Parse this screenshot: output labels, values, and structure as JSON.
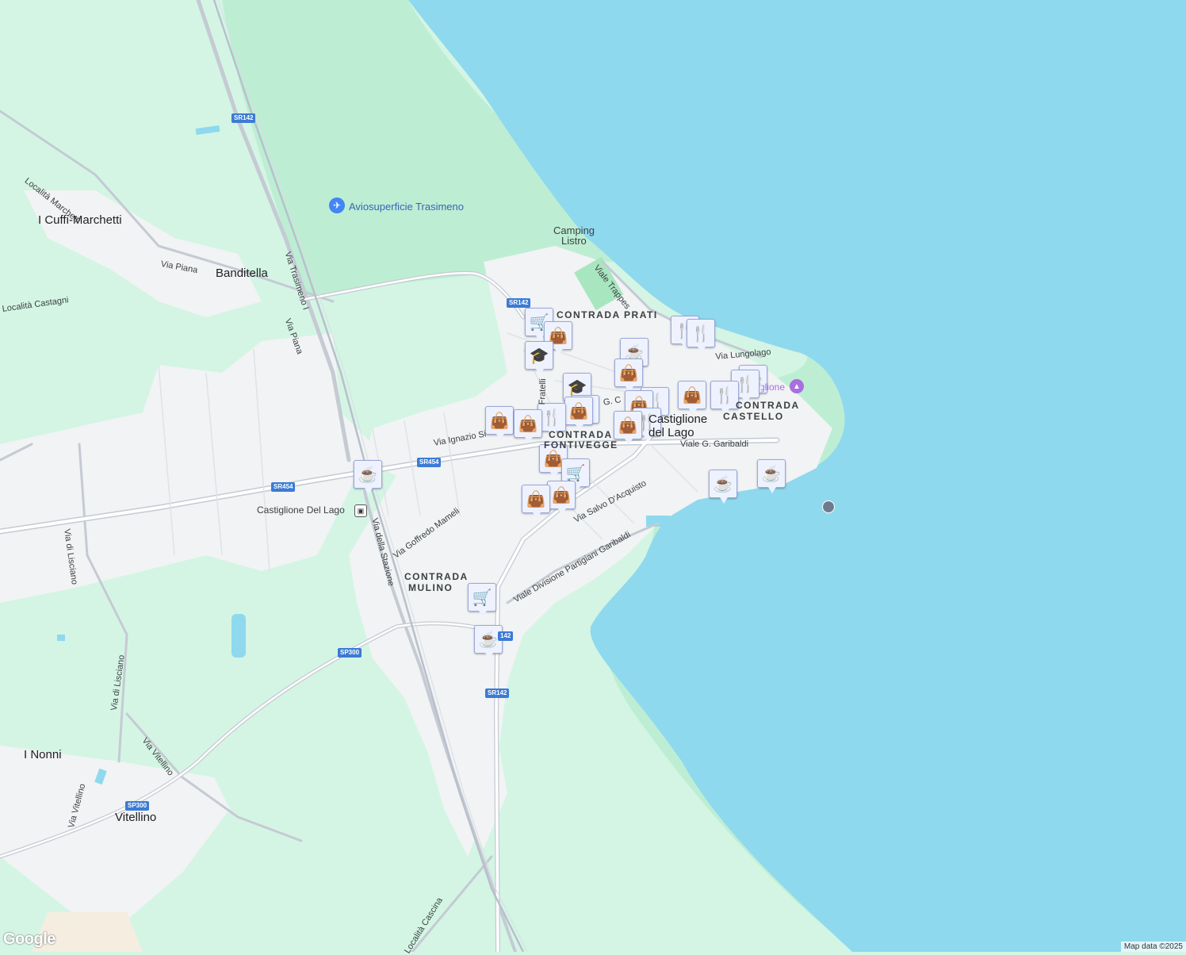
{
  "map": {
    "places": {
      "i_cuffi_marchetti": "I Cuffi-Marchetti",
      "banditella": "Banditella",
      "i_nonni": "I Nonni",
      "vitellino": "Vitellino",
      "camping_listro_1": "Camping",
      "camping_listro_2": "Listro",
      "airport": "Aviosuperficie Trasimeno",
      "station": "Castiglione Del Lago",
      "town_1": "Castiglione",
      "town_2": "del Lago",
      "museum": "Palazzo della Corgna - Castiglione"
    },
    "districts": {
      "prati": "CONTRADA PRATI",
      "castello_1": "CONTRADA",
      "castello_2": "CASTELLO",
      "fontivegge_1": "CONTRADA",
      "fontivegge_2": "FONTIVEGGE",
      "mulino_1": "CONTRADA",
      "mulino_2": "MULINO"
    },
    "roads": {
      "localita_marchetti": "Località Marchetti",
      "via_piana_1": "Via Piana",
      "via_piana_2": "Via Piana",
      "localita_castagni": "Località Castagni",
      "via_trasimeno": "Via Trasimeno I",
      "viale_trappes": "Viale Trappes",
      "via_lungolago": "Via Lungolago",
      "viale_garibaldi": "Viale G. Garibaldi",
      "via_ignazio": "Via Ignazio Si",
      "fratelli": "Fratelli",
      "via_salvo": "Via Salvo D'Acquisto",
      "via_mameli": "Via Goffredo Mameli",
      "via_stazione": "Via della Stazione",
      "viale_partigiani": "Viale Divisione Partigiani Garibaldi",
      "via_lisciano_1": "Via di Lisciano",
      "via_lisciano_2": "Via di Lisciano",
      "via_vitellino_1": "Via Vitellino",
      "via_vitellino_2": "Via Vitellino",
      "localita_cascina": "Località Cascina",
      "g_c": "G. C"
    },
    "shields": {
      "sr142_a": "SR142",
      "sr142_b": "SR142",
      "sr142_c": "SR142",
      "sr142_d": "142",
      "sr454_a": "SR454",
      "sr454_b": "SR454",
      "sp300_a": "SP300",
      "sp300_b": "SP300"
    },
    "poi_icons": [
      "shopping-cart-icon",
      "shopping-bag-icon",
      "restaurant-icon",
      "cafe-icon",
      "school-icon"
    ],
    "colors": {
      "water": "#8fd9ee",
      "land": "#d4f5e4",
      "park": "#bdeed3",
      "urban": "#f1f3f4",
      "poi_fill": "#eef2ff",
      "poi_glyph": "#123458",
      "shield": "#3b7bd4"
    }
  },
  "footer": {
    "logo": "Google",
    "attribution": "Map data ©2025"
  }
}
